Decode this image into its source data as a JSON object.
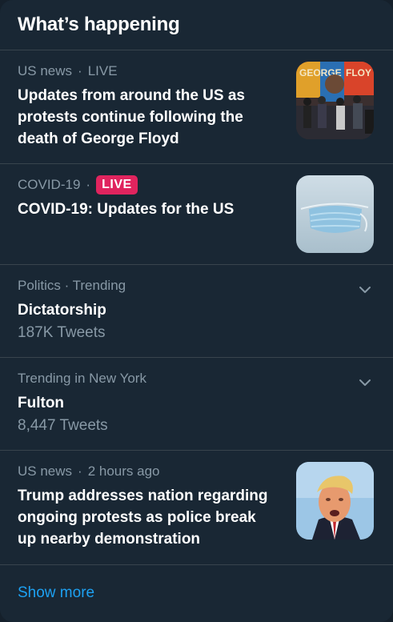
{
  "widget": {
    "title": "What’s happening"
  },
  "items": [
    {
      "category": "US news",
      "status": "LIVE",
      "headline": "Updates from around the US as protests continue following the death of George Floyd",
      "thumbnail": "protest-mural-photo"
    },
    {
      "category": "COVID-19",
      "badge": "LIVE",
      "headline": "COVID-19: Updates for the US",
      "thumbnail": "face-mask-photo"
    },
    {
      "category": "Politics · Trending",
      "headline": "Dictatorship",
      "count": "187K Tweets"
    },
    {
      "category": "Trending in New York",
      "headline": "Fulton",
      "count": "8,447 Tweets"
    },
    {
      "category": "US news",
      "time": "2 hours ago",
      "headline": "Trump addresses nation regarding ongoing protests as police break up nearby demonstration",
      "thumbnail": "trump-portrait-photo"
    }
  ],
  "footer": {
    "show_more": "Show more"
  },
  "colors": {
    "background": "#192734",
    "secondary_text": "#8899a6",
    "live_badge": "#e0245e",
    "link": "#1da1f2",
    "divider": "#38444d"
  }
}
